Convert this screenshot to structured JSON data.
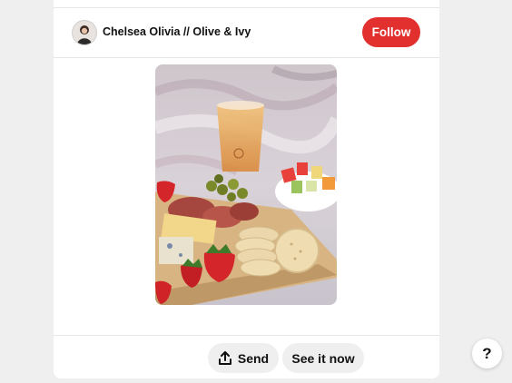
{
  "creator": {
    "name": "Chelsea Olivia // Olive & Ivy",
    "avatar_icon": "avatar-photo"
  },
  "header": {
    "follow_label": "Follow",
    "follow_color": "#e2302f"
  },
  "pin": {
    "image_icon": "charcuterie-board-photo"
  },
  "footer": {
    "send_label": "Send",
    "send_icon": "share-upload-icon",
    "see_it_now_label": "See it now"
  },
  "help": {
    "label": "?"
  }
}
